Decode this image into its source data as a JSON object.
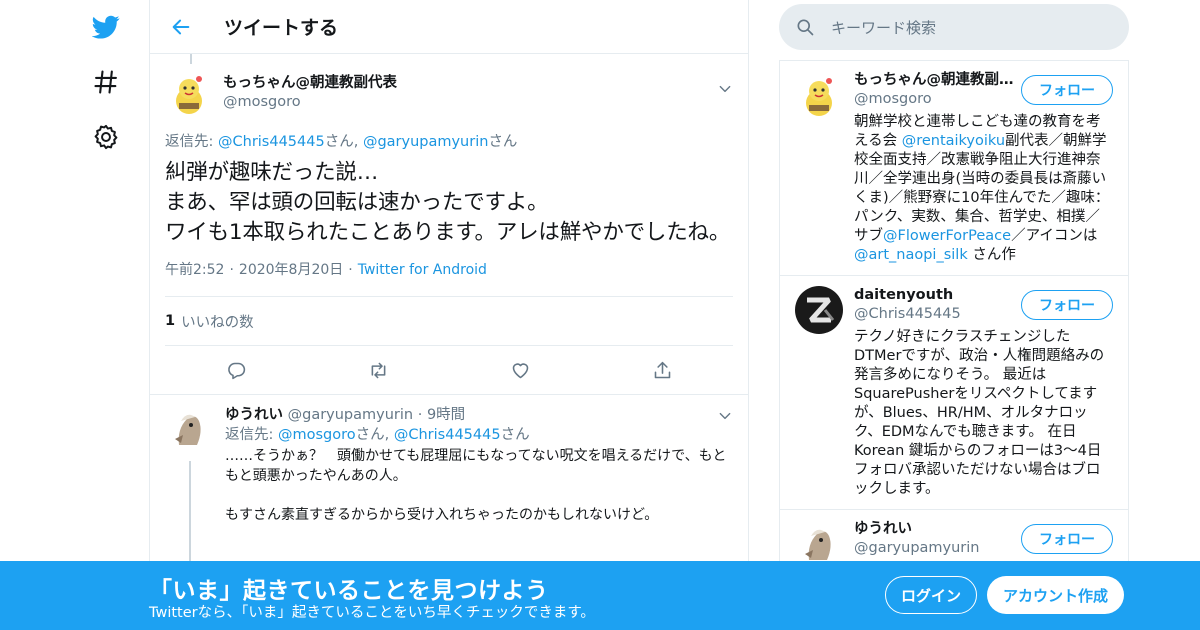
{
  "colors": {
    "brand": "#1da1f2",
    "link": "#1b95e0",
    "muted": "#657786",
    "border": "#e6ecf0"
  },
  "nav": {
    "icons": [
      "twitter-bird-icon",
      "hashtag-icon",
      "gear-icon"
    ]
  },
  "header": {
    "title": "ツイートする"
  },
  "tweet": {
    "display_name": "もっちゃん@朝連教副代表",
    "handle": "@mosgoro",
    "reply_prefix": "返信先: ",
    "reply_user1": "@Chris445445",
    "reply_mid": "さん, ",
    "reply_user2": "@garyupamyurin",
    "reply_suffix": "さん",
    "text": "糾弾が趣味だった説…\nまあ、罕は頭の回転は速かったですよ。\nワイも1本取られたことあります。アレは鮮やかでしたね。",
    "time": "午前2:52",
    "date": "2020年8月20日",
    "source": "Twitter for Android",
    "likes_count": "1",
    "likes_label": "いいねの数"
  },
  "reply": {
    "display_name": "ゆうれい",
    "handle": "@garyupamyurin",
    "age": "9時間",
    "reply_prefix": "返信先: ",
    "reply_user1": "@mosgoro",
    "reply_mid": "さん, ",
    "reply_user2": "@Chris445445",
    "reply_suffix": "さん",
    "text": "……そうかぁ？　頭働かせても屁理屈にもなってない呪文を唱えるだけで、もともと頭悪かったやんあの人。\n\nもすさん素直すぎるからから受け入れちゃったのかもしれないけど。"
  },
  "search": {
    "placeholder": "キーワード検索"
  },
  "users": [
    {
      "name": "もっちゃん@朝連教副代表",
      "handle": "@mosgoro",
      "follow": "フォロー",
      "bio_1": "朝鮮学校と連帯しこども達の教育を考える会 ",
      "bio_link1": "@rentaikyoiku",
      "bio_2": "副代表／朝鮮学校全面支持／改憲戦争阻止大行進神奈川／全学連出身(当時の委員長は斎藤いくま)／熊野寮に10年住んでた／趣味：パンク、実数、集合、哲学史、相撲／サブ",
      "bio_link2": "@FlowerForPeace",
      "bio_3": "／アイコンは ",
      "bio_link3": "@art_naopi_silk",
      "bio_4": " さん作"
    },
    {
      "name": "daitenyouth",
      "handle": "@Chris445445",
      "follow": "フォロー",
      "bio": "テクノ好きにクラスチェンジしたDTMerですが、政治・人権問題絡みの発言多めになりそう。 最近はSquarePusherをリスペクトしてますが、Blues、HR/HM、オルタナロック、EDMなんでも聴きます。 在日Korean 鍵垢からのフォローは3～4日フォロバ承認いただけない場合はブロックします。"
    },
    {
      "name": "ゆうれい",
      "handle": "@garyupamyurin",
      "follow": "フォロー"
    }
  ],
  "bottom": {
    "title": "「いま」起きていることを見つけよう",
    "subtitle": "Twitterなら、「いま」起きていることをいち早くチェックできます。",
    "login": "ログイン",
    "signup": "アカウント作成"
  }
}
